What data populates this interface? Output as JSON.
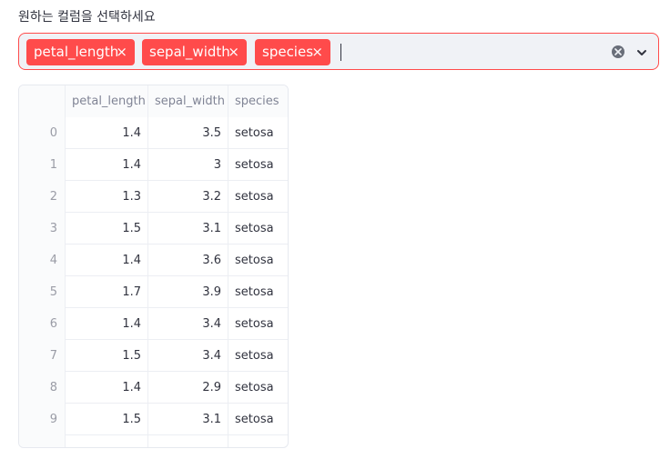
{
  "multiselect": {
    "label": "원하는 컬럼을 선택하세요",
    "selected": [
      "petal_length",
      "sepal_width",
      "species"
    ],
    "remove_glyph": "×",
    "accent_color": "#ff4b4b"
  },
  "table": {
    "columns": [
      "",
      "petal_length",
      "sepal_width",
      "species"
    ],
    "rows": [
      [
        "0",
        "1.4",
        "3.5",
        "setosa"
      ],
      [
        "1",
        "1.4",
        "3",
        "setosa"
      ],
      [
        "2",
        "1.3",
        "3.2",
        "setosa"
      ],
      [
        "3",
        "1.5",
        "3.1",
        "setosa"
      ],
      [
        "4",
        "1.4",
        "3.6",
        "setosa"
      ],
      [
        "5",
        "1.7",
        "3.9",
        "setosa"
      ],
      [
        "6",
        "1.4",
        "3.4",
        "setosa"
      ],
      [
        "7",
        "1.5",
        "3.4",
        "setosa"
      ],
      [
        "8",
        "1.4",
        "2.9",
        "setosa"
      ],
      [
        "9",
        "1.5",
        "3.1",
        "setosa"
      ]
    ]
  },
  "icons": {
    "clear": "clear-icon",
    "dropdown": "chevron-down-icon",
    "tag_remove": "close-icon"
  }
}
